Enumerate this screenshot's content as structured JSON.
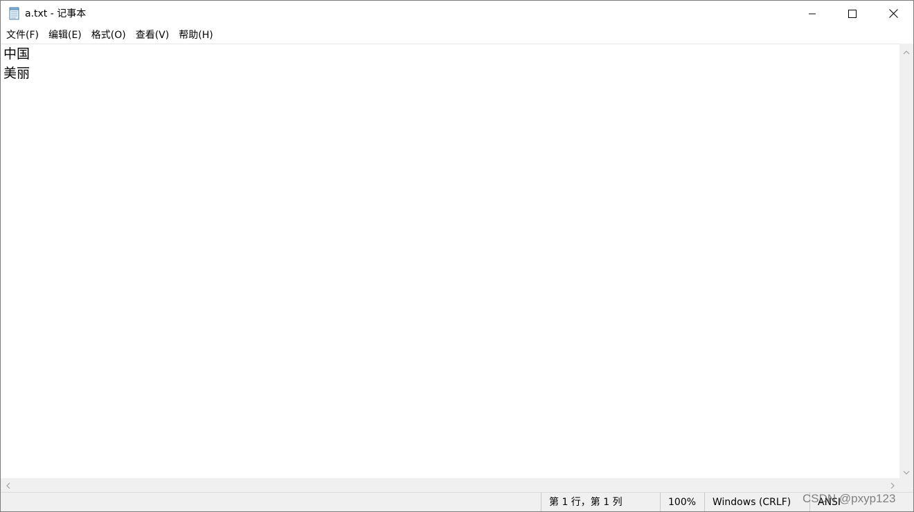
{
  "window": {
    "title": "a.txt - 记事本",
    "icon": "notepad-icon"
  },
  "window_controls": {
    "minimize_icon": "minimize-icon",
    "maximize_icon": "maximize-icon",
    "close_icon": "close-icon"
  },
  "menubar": {
    "items": [
      {
        "label": "文件(F)"
      },
      {
        "label": "编辑(E)"
      },
      {
        "label": "格式(O)"
      },
      {
        "label": "查看(V)"
      },
      {
        "label": "帮助(H)"
      }
    ]
  },
  "editor": {
    "lines": [
      "中国",
      "美丽"
    ]
  },
  "statusbar": {
    "position": "第 1 行，第 1 列",
    "zoom": "100%",
    "line_ending": "Windows (CRLF)",
    "encoding": "ANSI"
  },
  "watermark": {
    "text": "CSDN @pxyp123"
  },
  "colors": {
    "scrollbar_bg": "#f0f0f0",
    "statusbar_bg": "#f0f0f0",
    "window_border": "#7a7a7a"
  }
}
